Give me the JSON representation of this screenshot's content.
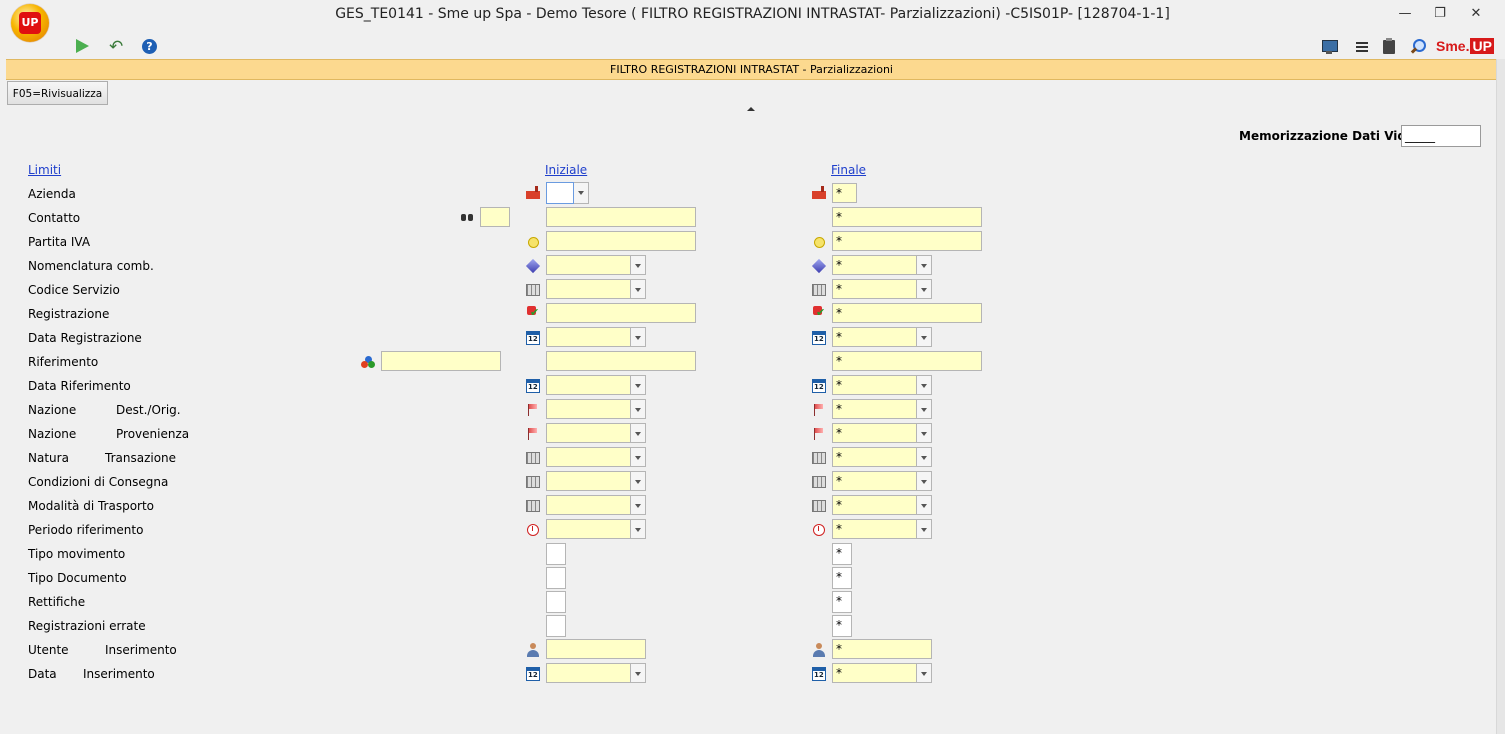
{
  "window": {
    "title": "GES_TE0141 - Sme up Spa  - Demo Tesore ( FILTRO REGISTRAZIONI INTRASTAT- Parzializzazioni) -C5IS01P- [128704-1-1]",
    "logo_text": "UP",
    "minimize": "—",
    "restore": "❐",
    "close": "✕"
  },
  "toolbar_right": {
    "brand_main": "Sme.",
    "brand_box": "UP"
  },
  "header": {
    "title": "FILTRO REGISTRAZIONI INTRASTAT -  Parzializzazioni"
  },
  "function_button": "F05=Rivisualizza",
  "memorization": {
    "label": "Memorizzazione Dati Video:",
    "value": "_____"
  },
  "columns": {
    "limits": "Limiti",
    "initial": "Iniziale",
    "final": "Finale"
  },
  "rows": [
    {
      "label": "Azienda",
      "sub": "",
      "initial": "",
      "final": "*"
    },
    {
      "label": "Contatto",
      "sub": "",
      "extra": "",
      "initial": "",
      "final": "*"
    },
    {
      "label": "Partita IVA",
      "sub": "",
      "initial": "",
      "final": "*"
    },
    {
      "label": "Nomenclatura comb.",
      "sub": "",
      "initial": "",
      "final": "*"
    },
    {
      "label": "Codice Servizio",
      "sub": "",
      "initial": "",
      "final": "*"
    },
    {
      "label": "Registrazione",
      "sub": "",
      "initial": "",
      "final": "*"
    },
    {
      "label": "Data Registrazione",
      "sub": "",
      "initial": "",
      "final": "*"
    },
    {
      "label": "Riferimento",
      "sub": "",
      "extra": "",
      "initial": "",
      "final": "*"
    },
    {
      "label": "Data Riferimento",
      "sub": "",
      "initial": "",
      "final": "*"
    },
    {
      "label": "Nazione",
      "sub": "Dest./Orig.",
      "initial": "",
      "final": "*"
    },
    {
      "label": "Nazione",
      "sub": "Provenienza",
      "initial": "",
      "final": "*"
    },
    {
      "label": "Natura",
      "sub": "Transazione",
      "initial": "",
      "final": "*"
    },
    {
      "label": "Condizioni di Consegna",
      "sub": "",
      "initial": "",
      "final": "*"
    },
    {
      "label": "Modalità di Trasporto",
      "sub": "",
      "initial": "",
      "final": "*"
    },
    {
      "label": "Periodo riferimento",
      "sub": "",
      "initial": "",
      "final": "*"
    },
    {
      "label": "Tipo movimento",
      "sub": "",
      "initial": "",
      "final": "*"
    },
    {
      "label": "Tipo Documento",
      "sub": "",
      "initial": "",
      "final": "*"
    },
    {
      "label": "Rettifiche",
      "sub": "",
      "initial": "",
      "final": "*"
    },
    {
      "label": "Registrazioni errate",
      "sub": "",
      "initial": "",
      "final": "*"
    },
    {
      "label": "Utente",
      "sub": "Inserimento",
      "initial": "",
      "final": "*"
    },
    {
      "label": "Data",
      "sub": "Inserimento",
      "initial": "",
      "final": "*"
    }
  ]
}
